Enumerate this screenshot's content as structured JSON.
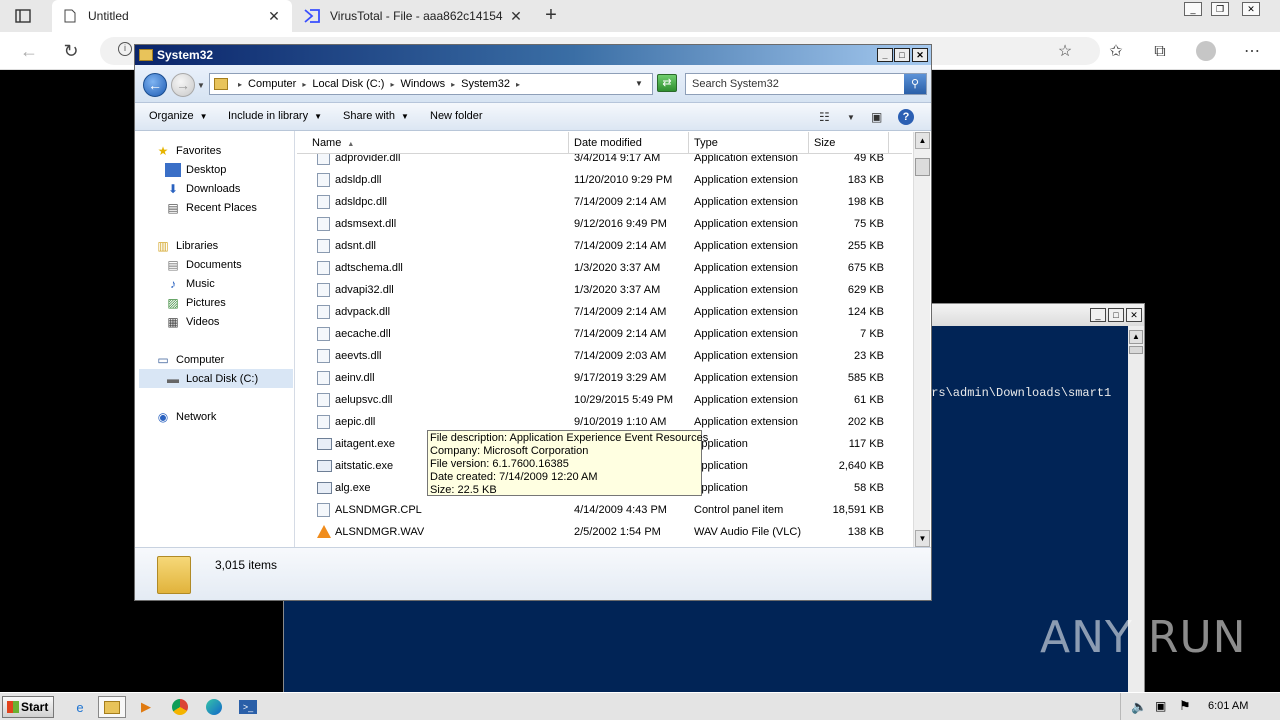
{
  "browser": {
    "tabs": [
      {
        "title": "Untitled",
        "icon": "page-icon",
        "active": true
      },
      {
        "title": "VirusTotal - File - aaa862c14154",
        "icon": "virustotal-icon",
        "active": false
      }
    ],
    "new_tab_glyph": "+",
    "close_glyph": "✕"
  },
  "explorer": {
    "title": "System32",
    "breadcrumb": [
      "Computer",
      "Local Disk (C:)",
      "Windows",
      "System32"
    ],
    "search_placeholder": "Search System32",
    "commands": [
      "Organize",
      "Include in library",
      "Share with",
      "New folder"
    ],
    "nav": {
      "favorites_header": "Favorites",
      "favorites": [
        "Desktop",
        "Downloads",
        "Recent Places"
      ],
      "libraries_header": "Libraries",
      "libraries": [
        "Documents",
        "Music",
        "Pictures",
        "Videos"
      ],
      "computer_header": "Computer",
      "computer": [
        "Local Disk (C:)"
      ],
      "network_header": "Network"
    },
    "columns": {
      "name": "Name",
      "date": "Date modified",
      "type": "Type",
      "size": "Size"
    },
    "files": [
      {
        "name": "adprovider.dll",
        "date": "3/4/2014 9:17 AM",
        "type": "Application extension",
        "size": "49 KB",
        "kind": "dll"
      },
      {
        "name": "adsldp.dll",
        "date": "11/20/2010 9:29 PM",
        "type": "Application extension",
        "size": "183 KB",
        "kind": "dll"
      },
      {
        "name": "adsldpc.dll",
        "date": "7/14/2009 2:14 AM",
        "type": "Application extension",
        "size": "198 KB",
        "kind": "dll"
      },
      {
        "name": "adsmsext.dll",
        "date": "9/12/2016 9:49 PM",
        "type": "Application extension",
        "size": "75 KB",
        "kind": "dll"
      },
      {
        "name": "adsnt.dll",
        "date": "7/14/2009 2:14 AM",
        "type": "Application extension",
        "size": "255 KB",
        "kind": "dll"
      },
      {
        "name": "adtschema.dll",
        "date": "1/3/2020 3:37 AM",
        "type": "Application extension",
        "size": "675 KB",
        "kind": "dll"
      },
      {
        "name": "advapi32.dll",
        "date": "1/3/2020 3:37 AM",
        "type": "Application extension",
        "size": "629 KB",
        "kind": "dll"
      },
      {
        "name": "advpack.dll",
        "date": "7/14/2009 2:14 AM",
        "type": "Application extension",
        "size": "124 KB",
        "kind": "dll"
      },
      {
        "name": "aecache.dll",
        "date": "7/14/2009 2:14 AM",
        "type": "Application extension",
        "size": "7 KB",
        "kind": "dll"
      },
      {
        "name": "aeevts.dll",
        "date": "7/14/2009 2:03 AM",
        "type": "Application extension",
        "size": "23 KB",
        "kind": "dll"
      },
      {
        "name": "aeinv.dll",
        "date": "9/17/2019 3:29 AM",
        "type": "Application extension",
        "size": "585 KB",
        "kind": "dll"
      },
      {
        "name": "aelupsvc.dll",
        "date": "10/29/2015 5:49 PM",
        "type": "Application extension",
        "size": "61 KB",
        "kind": "dll"
      },
      {
        "name": "aepic.dll",
        "date": "9/10/2019 1:10 AM",
        "type": "Application extension",
        "size": "202 KB",
        "kind": "dll"
      },
      {
        "name": "aitagent.exe",
        "date": "",
        "type": "Application",
        "size": "117 KB",
        "kind": "exe"
      },
      {
        "name": "aitstatic.exe",
        "date": "",
        "type": "Application",
        "size": "2,640 KB",
        "kind": "exe"
      },
      {
        "name": "alg.exe",
        "date": "",
        "type": "Application",
        "size": "58 KB",
        "kind": "exe"
      },
      {
        "name": "ALSNDMGR.CPL",
        "date": "4/14/2009 4:43 PM",
        "type": "Control panel item",
        "size": "18,591 KB",
        "kind": "dll"
      },
      {
        "name": "ALSNDMGR.WAV",
        "date": "2/5/2002 1:54 PM",
        "type": "WAV Audio File (VLC)",
        "size": "138 KB",
        "kind": "vlc"
      }
    ],
    "tooltip": [
      "File description: Application Experience Event Resources",
      "Company: Microsoft Corporation",
      "File version: 6.1.7600.16385",
      "Date created: 7/14/2009 12:20 AM",
      "Size: 22.5 KB"
    ],
    "status": "3,015 items"
  },
  "background_window": {
    "text": "ers\\admin\\Downloads\\smart1"
  },
  "watermark": "ANY RUN",
  "taskbar": {
    "start_label": "Start",
    "clock": "6:01 AM"
  },
  "colors": {
    "title_gradient_start": "#0a246a",
    "powershell_bg": "#012456",
    "tooltip_bg": "#ffffe1"
  }
}
